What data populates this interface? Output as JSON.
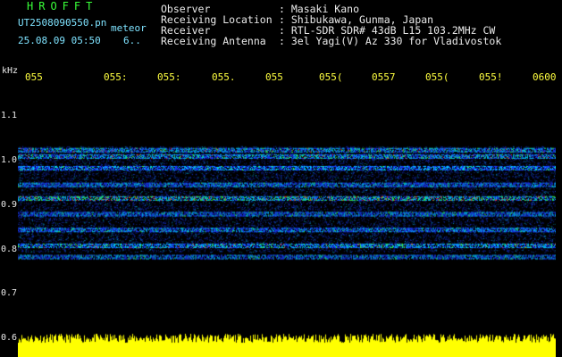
{
  "app_title": "HROFFT",
  "file": {
    "name": "UT2508090550.pn",
    "mode": "meteor",
    "datetime": "25.08.09 05:50",
    "count": "6.."
  },
  "station": [
    {
      "label": "Observer",
      "value": ": Masaki Kano"
    },
    {
      "label": "Receiving Location",
      "value": ": Shibukawa, Gunma, Japan"
    },
    {
      "label": "Receiver",
      "value": ": RTL-SDR SDR# 43dB L15 103.2MHz CW"
    },
    {
      "label": "Receiving Antenna",
      "value": ": 3el Yagi(V) Az 330 for Vladivostok"
    }
  ],
  "time_axis": [
    "055",
    "055:",
    "055:",
    "055.",
    "055",
    "055(",
    "0557",
    "055(",
    "055!",
    "0600"
  ],
  "freq_axis": {
    "unit": "kHz",
    "ticks": [
      "1.1",
      "1.0",
      "0.9",
      "0.8",
      "0.7",
      "0.6"
    ]
  },
  "spectrogram": {
    "freq_range_khz": [
      0.6,
      1.15
    ],
    "carriers_khz": [
      1.012,
      0.998,
      0.972,
      0.935,
      0.905,
      0.87,
      0.835,
      0.8,
      0.775
    ],
    "colors": {
      "background": "#000000",
      "weak": "#1a3cff",
      "medium": "#00d0ff",
      "strong": "#40ff40",
      "peak": "#ff3030",
      "power_strip": "#ffff00"
    }
  }
}
